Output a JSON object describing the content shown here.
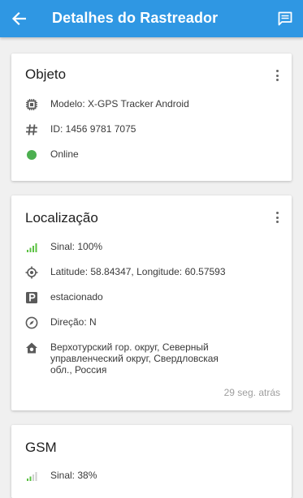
{
  "appbar": {
    "title": "Detalhes do Rastreador",
    "back_icon": "back-arrow-icon",
    "message_icon": "message-icon"
  },
  "colors": {
    "primary": "#2f97e3",
    "online": "#4caf50",
    "signal": "#59c140",
    "icon": "#5a5a5a"
  },
  "objeto": {
    "title": "Objeto",
    "model": "Modelo: X-GPS Tracker Android",
    "id": "ID: 1456 9781 7075",
    "status": "Online"
  },
  "localizacao": {
    "title": "Localização",
    "signal": "Sinal: 100%",
    "coords": "Latitude: 58.84347, Longitude: 60.57593",
    "parking": "estacionado",
    "direction": "Direção: N",
    "address": "Верхотурский гор. округ, Северный управленческий округ, Свердловская обл., Россия",
    "time_ago": "29 seg. atrás"
  },
  "gsm": {
    "title": "GSM",
    "signal": "Sinal: 38%"
  }
}
